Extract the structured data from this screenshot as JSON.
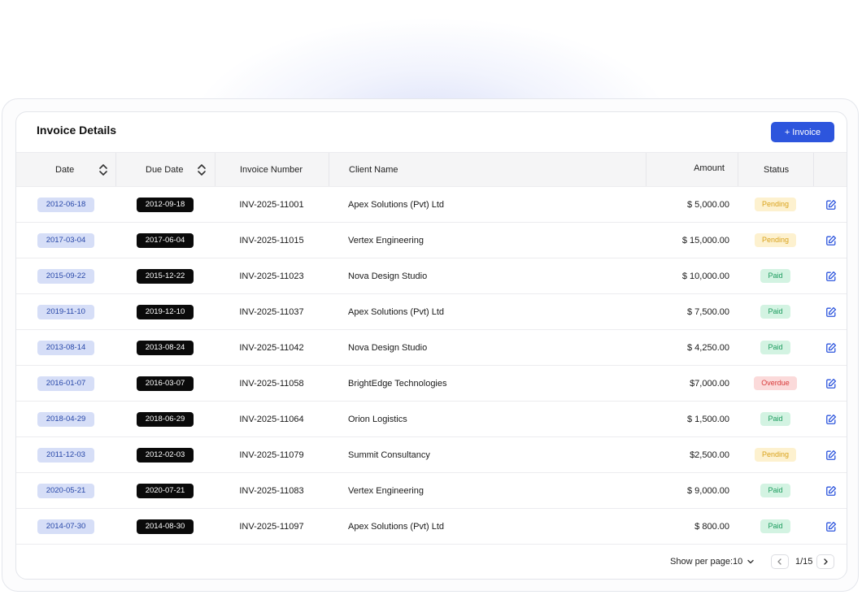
{
  "header": {
    "title": "Invoice Details",
    "add_button_label": "+ Invoice"
  },
  "columns": {
    "date": "Date",
    "due_date": "Due Date",
    "invoice_number": "Invoice Number",
    "client_name": "Client Name",
    "amount": "Amount",
    "status": "Status"
  },
  "rows": [
    {
      "date": "2012-06-18",
      "due": "2012-09-18",
      "invoice": "INV-2025-11001",
      "client": "Apex Solutions (Pvt) Ltd",
      "amount": "$ 5,000.00",
      "status": "Pending",
      "status_type": "pending"
    },
    {
      "date": "2017-03-04",
      "due": "2017-06-04",
      "invoice": "INV-2025-11015",
      "client": "Vertex Engineering",
      "amount": "$ 15,000.00",
      "status": "Pending",
      "status_type": "pending"
    },
    {
      "date": "2015-09-22",
      "due": "2015-12-22",
      "invoice": "INV-2025-11023",
      "client": "Nova Design Studio",
      "amount": "$ 10,000.00",
      "status": "Paid",
      "status_type": "paid"
    },
    {
      "date": "2019-11-10",
      "due": "2019-12-10",
      "invoice": "INV-2025-11037",
      "client": "Apex Solutions (Pvt) Ltd",
      "amount": "$ 7,500.00",
      "status": "Paid",
      "status_type": "paid"
    },
    {
      "date": "2013-08-14",
      "due": "2013-08-24",
      "invoice": "INV-2025-11042",
      "client": "Nova Design Studio",
      "amount": "$ 4,250.00",
      "status": "Paid",
      "status_type": "paid"
    },
    {
      "date": "2016-01-07",
      "due": "2016-03-07",
      "invoice": "INV-2025-11058",
      "client": "BrightEdge Technologies",
      "amount": "$7,000.00",
      "status": "Overdue",
      "status_type": "overdue"
    },
    {
      "date": "2018-04-29",
      "due": "2018-06-29",
      "invoice": "INV-2025-11064",
      "client": "Orion Logistics",
      "amount": "$ 1,500.00",
      "status": "Paid",
      "status_type": "paid"
    },
    {
      "date": "2011-12-03",
      "due": "2012-02-03",
      "invoice": "INV-2025-11079",
      "client": "Summit Consultancy",
      "amount": "$2,500.00",
      "status": "Pending",
      "status_type": "pending"
    },
    {
      "date": "2020-05-21",
      "due": "2020-07-21",
      "invoice": "INV-2025-11083",
      "client": "Vertex Engineering",
      "amount": "$ 9,000.00",
      "status": "Paid",
      "status_type": "paid"
    },
    {
      "date": "2014-07-30",
      "due": "2014-08-30",
      "invoice": "INV-2025-11097",
      "client": "Apex Solutions (Pvt) Ltd",
      "amount": "$ 800.00",
      "status": "Paid",
      "status_type": "paid"
    }
  ],
  "pagination": {
    "per_page_label": "Show per page:",
    "per_page_value": "10",
    "page_info": "1/15"
  },
  "colors": {
    "primary": "#2d55dd",
    "date_pill_bg": "#d6def7",
    "due_pill_bg": "#0a0a0a",
    "pending": "#d9a21b",
    "paid": "#1b9b5d",
    "overdue": "#d83a3a"
  },
  "icons": {
    "sort": "sort-icon",
    "edit": "edit-icon",
    "chevron": "chevron-down-icon",
    "prev": "chevron-left-icon",
    "next": "chevron-right-icon"
  }
}
